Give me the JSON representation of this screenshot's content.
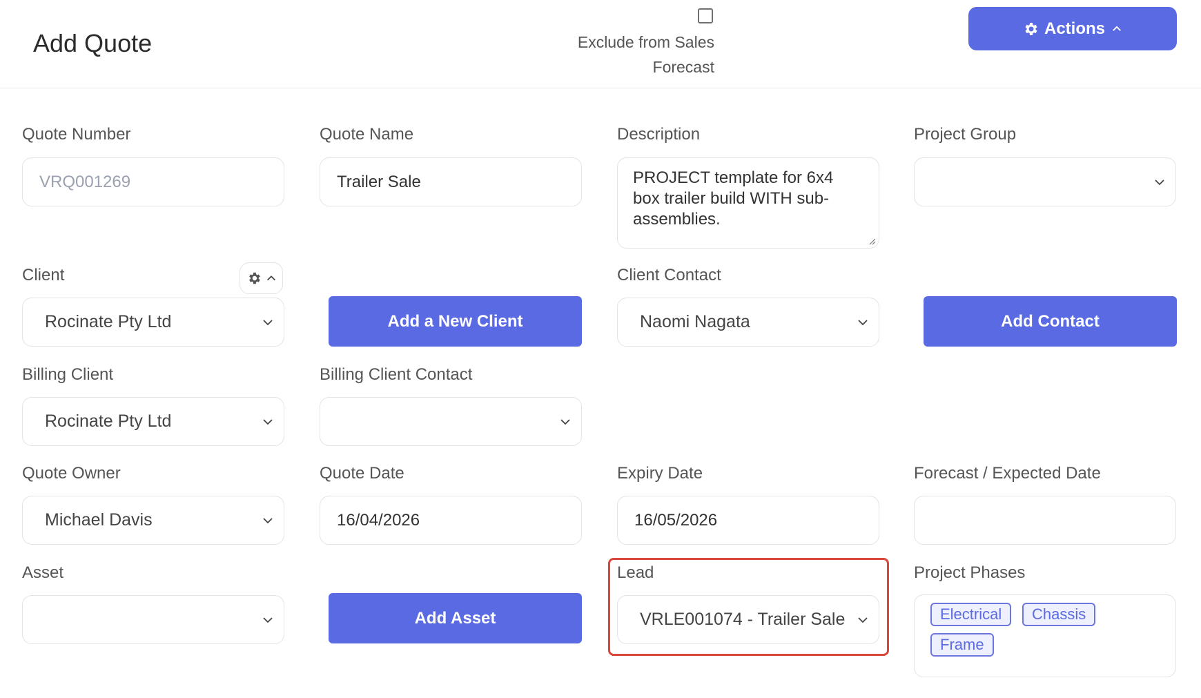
{
  "header": {
    "title": "Add Quote",
    "exclude_label_line1": "Exclude from Sales",
    "exclude_label_line2": "Forecast",
    "actions_label": "Actions"
  },
  "form": {
    "quote_number": {
      "label": "Quote Number",
      "value": "VRQ001269"
    },
    "quote_name": {
      "label": "Quote Name",
      "value": "Trailer Sale"
    },
    "description": {
      "label": "Description",
      "value": "PROJECT template for 6x4 box trailer build WITH sub-assemblies."
    },
    "project_group": {
      "label": "Project Group",
      "value": ""
    },
    "client": {
      "label": "Client",
      "value": "Rocinate Pty Ltd"
    },
    "add_client_button": "Add a New Client",
    "client_contact": {
      "label": "Client Contact",
      "value": "Naomi Nagata"
    },
    "add_contact_button": "Add Contact",
    "billing_client": {
      "label": "Billing Client",
      "value": "Rocinate Pty Ltd"
    },
    "billing_client_contact": {
      "label": "Billing Client Contact",
      "value": ""
    },
    "quote_owner": {
      "label": "Quote Owner",
      "value": "Michael Davis"
    },
    "quote_date": {
      "label": "Quote Date",
      "value": "16/04/2026"
    },
    "expiry_date": {
      "label": "Expiry Date",
      "value": "16/05/2026"
    },
    "forecast_date": {
      "label": "Forecast / Expected Date",
      "value": ""
    },
    "asset": {
      "label": "Asset",
      "value": ""
    },
    "add_asset_button": "Add Asset",
    "lead": {
      "label": "Lead",
      "value": "VRLE001074 - Trailer Sale"
    },
    "project_phases": {
      "label": "Project Phases",
      "chips": [
        "Electrical",
        "Chassis",
        "Frame"
      ]
    }
  },
  "colors": {
    "accent": "#5a6ae2",
    "highlight": "#d9463a"
  }
}
